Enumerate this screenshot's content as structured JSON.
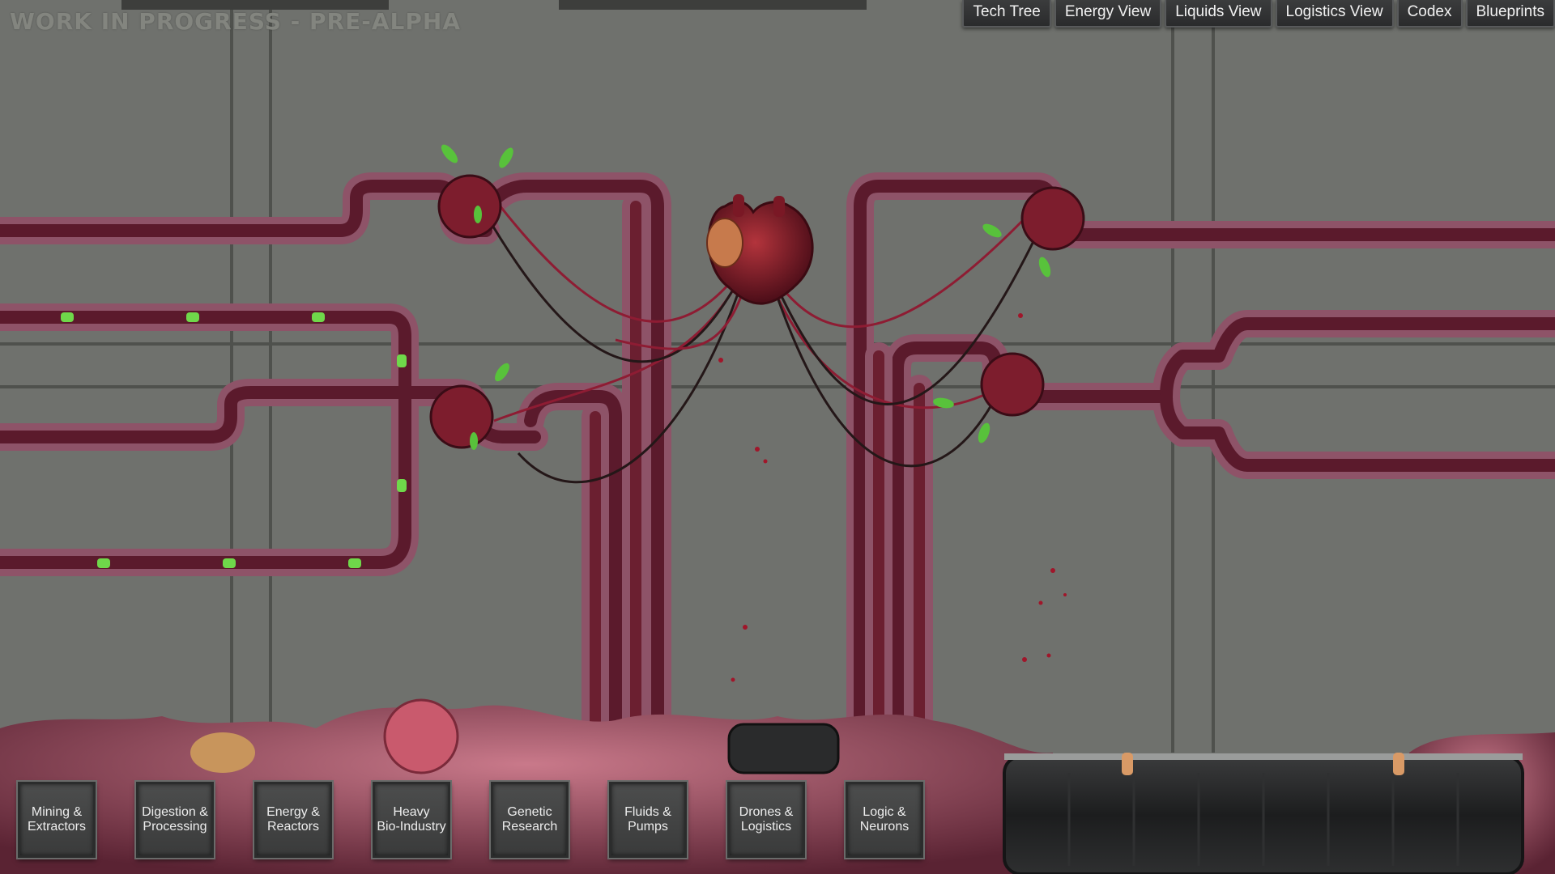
{
  "watermark": "WORK IN PROGRESS - PRE-ALPHA",
  "views": [
    {
      "label": "Tech Tree"
    },
    {
      "label": "Energy View"
    },
    {
      "label": "Liquids View"
    },
    {
      "label": "Logistics View"
    },
    {
      "label": "Codex"
    },
    {
      "label": "Blueprints"
    }
  ],
  "categories": [
    {
      "label": "Mining &\nExtractors"
    },
    {
      "label": "Digestion &\nProcessing"
    },
    {
      "label": "Energy &\nReactors"
    },
    {
      "label": "Heavy\nBio-Industry"
    },
    {
      "label": "Genetic\nResearch"
    },
    {
      "label": "Fluids &\nPumps"
    },
    {
      "label": "Drones &\nLogistics"
    },
    {
      "label": "Logic &\nNeurons"
    }
  ],
  "colors": {
    "wall": "#6f716d",
    "panel_line": "#4d4f4c",
    "pipe_outer": "#8e5368",
    "pipe_inner": "#5b1a2c",
    "pipe_core": "#7a2036",
    "node": "#7d1d2d",
    "heart": "#8a1f2a",
    "slime": "#6fd84a",
    "flesh": "#a0566a",
    "cable": "#2a1c1f"
  }
}
